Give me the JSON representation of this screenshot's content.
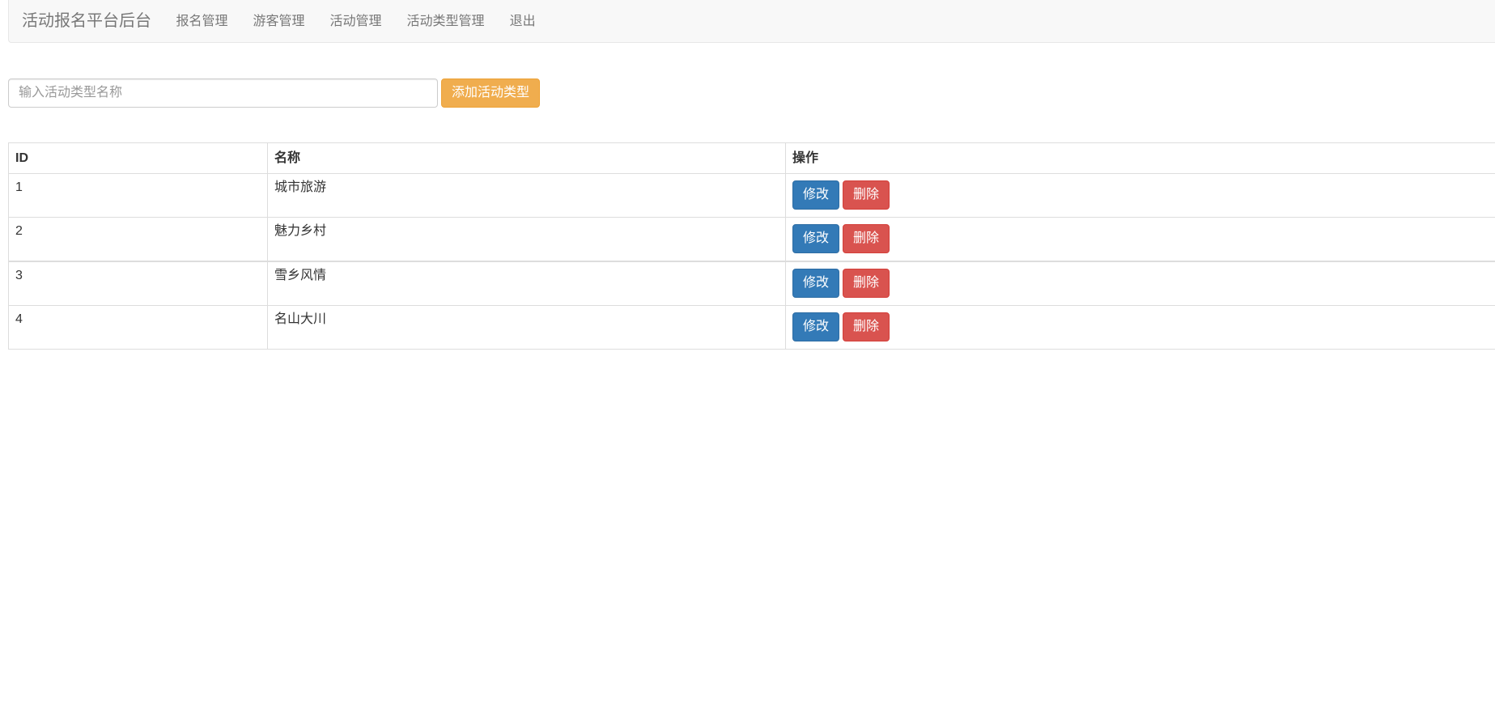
{
  "navbar": {
    "brand": "活动报名平台后台",
    "items": [
      {
        "label": "报名管理"
      },
      {
        "label": "游客管理"
      },
      {
        "label": "活动管理"
      },
      {
        "label": "活动类型管理"
      },
      {
        "label": "退出"
      }
    ]
  },
  "toolbar": {
    "input_placeholder": "输入活动类型名称",
    "input_value": "",
    "add_button_label": "添加活动类型"
  },
  "table": {
    "headers": {
      "id": "ID",
      "name": "名称",
      "ops": "操作"
    },
    "rows": [
      {
        "id": "1",
        "name": "城市旅游",
        "edit_label": "修改",
        "delete_label": "删除"
      },
      {
        "id": "2",
        "name": "魅力乡村",
        "edit_label": "修改",
        "delete_label": "删除"
      },
      {
        "id": "3",
        "name": "雪乡风情",
        "edit_label": "修改",
        "delete_label": "删除"
      },
      {
        "id": "4",
        "name": "名山大川",
        "edit_label": "修改",
        "delete_label": "删除"
      }
    ]
  },
  "colors": {
    "navbar_bg": "#f8f8f8",
    "warning": "#f0ad4e",
    "primary": "#337ab7",
    "danger": "#d9534f"
  }
}
